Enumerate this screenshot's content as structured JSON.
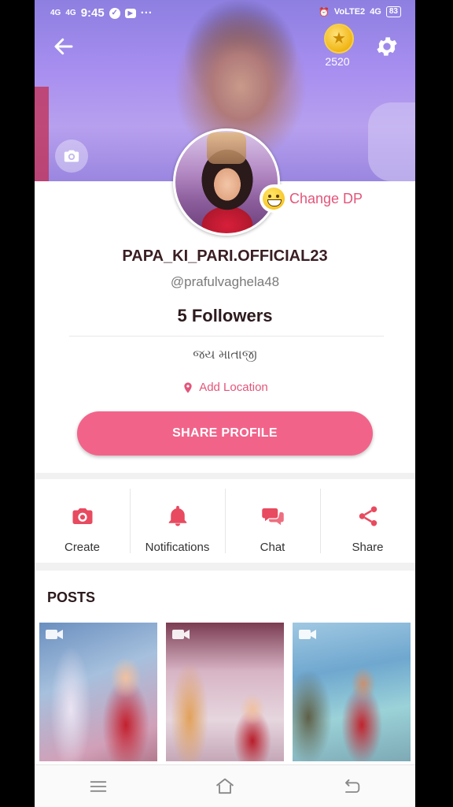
{
  "status_bar": {
    "left_signal_1": "4G",
    "left_signal_2": "4G",
    "time": "9:45",
    "dots": "···",
    "right_volte": "VoLTE2",
    "right_net": "4G",
    "battery": "83"
  },
  "header": {
    "coin_count": "2520"
  },
  "profile": {
    "change_dp_label": "Change DP",
    "username": "PAPA_KI_PARI.OFFICIAL23",
    "handle": "@prafulvaghela48",
    "followers": "5 Followers",
    "bio": "જય માતાજી",
    "add_location_label": "Add Location",
    "share_profile_label": "SHARE PROFILE"
  },
  "actions": [
    {
      "label": "Create",
      "icon": "camera-icon"
    },
    {
      "label": "Notifications",
      "icon": "bell-icon"
    },
    {
      "label": "Chat",
      "icon": "chat-icon"
    },
    {
      "label": "Share",
      "icon": "share-icon"
    }
  ],
  "posts": {
    "title": "POSTS",
    "items": [
      {
        "type": "video"
      },
      {
        "type": "video"
      },
      {
        "type": "video"
      }
    ]
  },
  "colors": {
    "accent": "#f2638a",
    "accent_text": "#e3557a"
  }
}
